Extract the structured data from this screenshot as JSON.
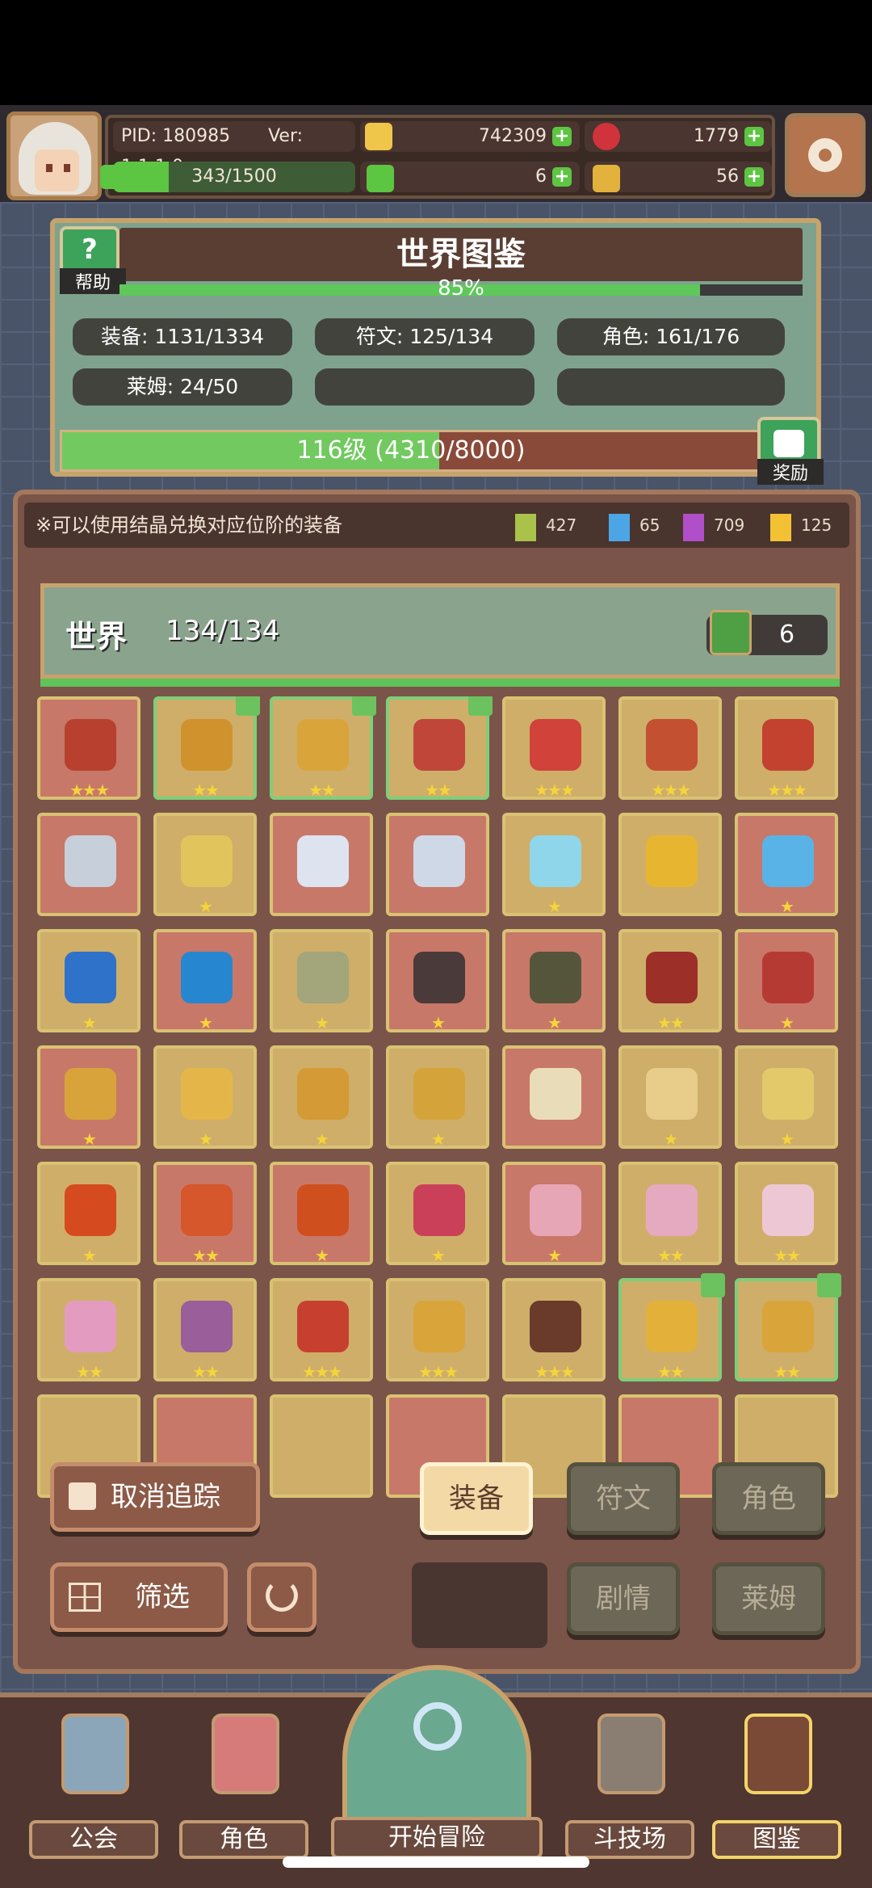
{
  "hud": {
    "pid": "PID: 180985",
    "version": "Ver: 1.1.1.0",
    "gold": "742309",
    "ruby": "1779",
    "hp": "343/1500",
    "clover": "6",
    "key": "56",
    "hp_fraction": 0.23
  },
  "codex": {
    "title": "世界图鉴",
    "help_label": "帮助",
    "percent": "85%",
    "percent_value": 0.85,
    "stats": [
      "装备: 1131/1334",
      "符文: 125/134",
      "角色: 161/176",
      "莱姆: 24/50"
    ],
    "level_text": "116级 (4310/8000)",
    "level_fraction": 0.54,
    "reward_label": "奖励"
  },
  "panel": {
    "tip": "※可以使用结晶兑换对应位阶的装备",
    "gems": [
      {
        "name": "green-crystal",
        "color": "#a9c24a",
        "value": "427"
      },
      {
        "name": "blue-crystal",
        "color": "#4ca6e6",
        "value": "65"
      },
      {
        "name": "purple-crystal",
        "color": "#b04fc7",
        "value": "709"
      },
      {
        "name": "gold-crystal",
        "color": "#f2c234",
        "value": "125"
      }
    ],
    "world_title": "世界",
    "world_count": "134/134",
    "like_count": "6"
  },
  "items": [
    {
      "name": "bowl",
      "bg": "red",
      "color": "#b8402e",
      "stars": "★★★",
      "green": false,
      "like": false
    },
    {
      "name": "mace",
      "bg": "gold",
      "color": "#d0922d",
      "stars": "★★",
      "green": true,
      "like": true
    },
    {
      "name": "ring",
      "bg": "gold",
      "color": "#d9a53a",
      "stars": "★★",
      "green": true,
      "like": true
    },
    {
      "name": "armor",
      "bg": "gold",
      "color": "#c0463a",
      "stars": "★★",
      "green": true,
      "like": true
    },
    {
      "name": "gauntlet",
      "bg": "gold",
      "color": "#d0423a",
      "stars": "★★★",
      "green": false,
      "like": false
    },
    {
      "name": "necklace",
      "bg": "gold",
      "color": "#c45032",
      "stars": "★★★",
      "green": false,
      "like": false
    },
    {
      "name": "boots",
      "bg": "gold",
      "color": "#c2412f",
      "stars": "★★★",
      "green": false,
      "like": false
    },
    {
      "name": "sword",
      "bg": "red",
      "color": "#c7d0da",
      "stars": "",
      "green": false,
      "like": false
    },
    {
      "name": "shield",
      "bg": "gold",
      "color": "#e2c45c",
      "stars": "★",
      "green": false,
      "like": false
    },
    {
      "name": "tome",
      "bg": "red",
      "color": "#dde4ef",
      "stars": "",
      "green": false,
      "like": false
    },
    {
      "name": "crystal-sword",
      "bg": "red",
      "color": "#cfd8e6",
      "stars": "",
      "green": false,
      "like": false
    },
    {
      "name": "crystal-necklace",
      "bg": "gold",
      "color": "#8fd6ea",
      "stars": "★",
      "green": false,
      "like": false
    },
    {
      "name": "topaz-ring",
      "bg": "gold",
      "color": "#e8b531",
      "stars": "",
      "green": false,
      "like": false
    },
    {
      "name": "blue-staff",
      "bg": "red",
      "color": "#5ab3e6",
      "stars": "★",
      "green": false,
      "like": false
    },
    {
      "name": "blue-orb",
      "bg": "gold",
      "color": "#2f72c9",
      "stars": "★",
      "green": false,
      "like": false
    },
    {
      "name": "blue-heart",
      "bg": "red",
      "color": "#2786d0",
      "stars": "★",
      "green": false,
      "like": false
    },
    {
      "name": "amethyst-ring",
      "bg": "gold",
      "color": "#a3a57a",
      "stars": "★",
      "green": false,
      "like": false
    },
    {
      "name": "dark-necklace",
      "bg": "red",
      "color": "#4a3a3a",
      "stars": "★",
      "green": false,
      "like": false
    },
    {
      "name": "dark-bottle",
      "bg": "red",
      "color": "#55553c",
      "stars": "★",
      "green": false,
      "like": false
    },
    {
      "name": "red-armor",
      "bg": "gold",
      "color": "#9c2f28",
      "stars": "★★",
      "green": false,
      "like": false
    },
    {
      "name": "red-choker",
      "bg": "red",
      "color": "#b63a34",
      "stars": "★",
      "green": false,
      "like": false
    },
    {
      "name": "potion",
      "bg": "red",
      "color": "#d9a33b",
      "stars": "★",
      "green": false,
      "like": false
    },
    {
      "name": "crown",
      "bg": "gold",
      "color": "#e4b64a",
      "stars": "★",
      "green": false,
      "like": false
    },
    {
      "name": "gem-ring",
      "bg": "gold",
      "color": "#d49a35",
      "stars": "★",
      "green": false,
      "like": false
    },
    {
      "name": "heart-pendant",
      "bg": "gold",
      "color": "#d4a43a",
      "stars": "★",
      "green": false,
      "like": false
    },
    {
      "name": "bow",
      "bg": "red",
      "color": "#e9dcb8",
      "stars": "",
      "green": false,
      "like": false
    },
    {
      "name": "staff",
      "bg": "gold",
      "color": "#e7cc8a",
      "stars": "★",
      "green": false,
      "like": false
    },
    {
      "name": "gold-band",
      "bg": "gold",
      "color": "#e3c96a",
      "stars": "★",
      "green": false,
      "like": false
    },
    {
      "name": "fire-gem",
      "bg": "gold",
      "color": "#d54a1e",
      "stars": "★",
      "green": false,
      "like": false
    },
    {
      "name": "fire-heart",
      "bg": "red",
      "color": "#d6572b",
      "stars": "★★",
      "green": false,
      "like": false
    },
    {
      "name": "fire-ring",
      "bg": "red",
      "color": "#cf4f1f",
      "stars": "★",
      "green": false,
      "like": false
    },
    {
      "name": "teddy-bear",
      "bg": "gold",
      "color": "#c94058",
      "stars": "★",
      "green": false,
      "like": false
    },
    {
      "name": "pink-bear-hat",
      "bg": "red",
      "color": "#e7a6b6",
      "stars": "★",
      "green": false,
      "like": false
    },
    {
      "name": "pink-dress",
      "bg": "gold",
      "color": "#e5aac0",
      "stars": "★★",
      "green": false,
      "like": false
    },
    {
      "name": "pink-shell",
      "bg": "gold",
      "color": "#eec7d5",
      "stars": "★★",
      "green": false,
      "like": false
    },
    {
      "name": "wing-heart",
      "bg": "gold",
      "color": "#e39cc0",
      "stars": "★★",
      "green": false,
      "like": false
    },
    {
      "name": "purple-ring",
      "bg": "gold",
      "color": "#9a5e9a",
      "stars": "★★",
      "green": false,
      "like": false
    },
    {
      "name": "bone-wand",
      "bg": "gold",
      "color": "#c7402f",
      "stars": "★★★",
      "green": false,
      "like": false
    },
    {
      "name": "gold-ring",
      "bg": "gold",
      "color": "#d9a53a",
      "stars": "★★★",
      "green": false,
      "like": false
    },
    {
      "name": "gold-boots",
      "bg": "gold",
      "color": "#6a3a2a",
      "stars": "★★★",
      "green": false,
      "like": false
    },
    {
      "name": "ruby-brooch",
      "bg": "gold",
      "color": "#e3b03a",
      "stars": "★★",
      "green": true,
      "like": true
    },
    {
      "name": "ruby-collar",
      "bg": "gold",
      "color": "#d9a53a",
      "stars": "★★",
      "green": true,
      "like": true
    }
  ],
  "buttons": {
    "untrack": "取消追踪",
    "filter": "筛选",
    "tab_equipment": "装备",
    "tab_rune": "符文",
    "tab_character": "角色",
    "tab_story": "剧情",
    "tab_slime": "莱姆"
  },
  "nav": {
    "guild": "公会",
    "character": "角色",
    "adventure": "开始冒险",
    "arena": "斗技场",
    "codex": "图鉴"
  }
}
